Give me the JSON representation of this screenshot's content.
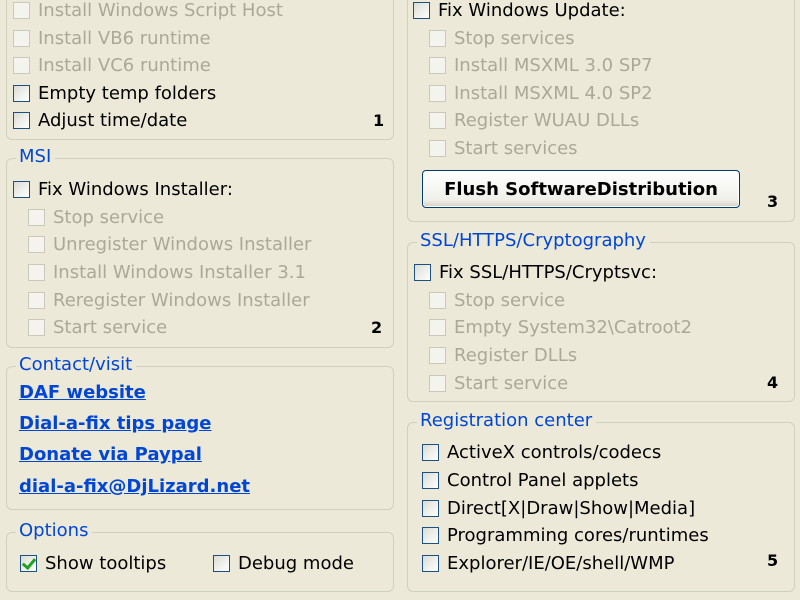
{
  "left_top": {
    "items": [
      {
        "label": "Install Windows Script Host",
        "checked": false,
        "disabled": true
      },
      {
        "label": "Install VB6 runtime",
        "checked": false,
        "disabled": true
      },
      {
        "label": "Install VC6 runtime",
        "checked": false,
        "disabled": true
      },
      {
        "label": "Empty temp folders",
        "checked": false,
        "disabled": false
      },
      {
        "label": "Adjust time/date",
        "checked": false,
        "disabled": false
      }
    ],
    "number": "1"
  },
  "msi": {
    "title": "MSI",
    "main": {
      "label": "Fix Windows Installer:",
      "checked": false,
      "disabled": false
    },
    "items": [
      {
        "label": "Stop service",
        "checked": false,
        "disabled": true
      },
      {
        "label": "Unregister Windows Installer",
        "checked": false,
        "disabled": true
      },
      {
        "label": "Install Windows Installer 3.1",
        "checked": false,
        "disabled": true
      },
      {
        "label": "Reregister Windows Installer",
        "checked": false,
        "disabled": true
      },
      {
        "label": "Start service",
        "checked": false,
        "disabled": true
      }
    ],
    "number": "2"
  },
  "contact": {
    "title": "Contact/visit",
    "links": [
      "DAF website",
      "Dial-a-fix tips page",
      "Donate via Paypal",
      "dial-a-fix@DjLizard.net"
    ]
  },
  "options": {
    "title": "Options",
    "show_tooltips": {
      "label": "Show tooltips",
      "checked": true
    },
    "debug_mode": {
      "label": "Debug mode",
      "checked": false
    }
  },
  "windows_update": {
    "main": {
      "label": "Fix Windows Update:",
      "checked": false,
      "disabled": false
    },
    "items": [
      {
        "label": "Stop services",
        "checked": false,
        "disabled": true
      },
      {
        "label": "Install MSXML 3.0 SP7",
        "checked": false,
        "disabled": true
      },
      {
        "label": "Install MSXML 4.0 SP2",
        "checked": false,
        "disabled": true
      },
      {
        "label": "Register WUAU DLLs",
        "checked": false,
        "disabled": true
      },
      {
        "label": "Start services",
        "checked": false,
        "disabled": true
      }
    ],
    "flush_button": "Flush SoftwareDistribution",
    "number": "3"
  },
  "ssl": {
    "title": "SSL/HTTPS/Cryptography",
    "main": {
      "label": "Fix SSL/HTTPS/Cryptsvc:",
      "checked": false,
      "disabled": false
    },
    "items": [
      {
        "label": "Stop service",
        "checked": false,
        "disabled": true
      },
      {
        "label": "Empty System32\\Catroot2",
        "checked": false,
        "disabled": true
      },
      {
        "label": "Register DLLs",
        "checked": false,
        "disabled": true
      },
      {
        "label": "Start service",
        "checked": false,
        "disabled": true
      }
    ],
    "number": "4"
  },
  "registration": {
    "title": "Registration center",
    "items": [
      {
        "label": "ActiveX controls/codecs",
        "checked": false,
        "disabled": false
      },
      {
        "label": "Control Panel applets",
        "checked": false,
        "disabled": false
      },
      {
        "label": "Direct[X|Draw|Show|Media]",
        "checked": false,
        "disabled": false
      },
      {
        "label": "Programming cores/runtimes",
        "checked": false,
        "disabled": false
      },
      {
        "label": "Explorer/IE/OE/shell/WMP",
        "checked": false,
        "disabled": false
      }
    ],
    "number": "5"
  },
  "colors": {
    "legend": "#0046d5",
    "link": "#0046d5",
    "disabled_text": "#aca899",
    "check": "#21a121",
    "background": "#ece9d8"
  }
}
